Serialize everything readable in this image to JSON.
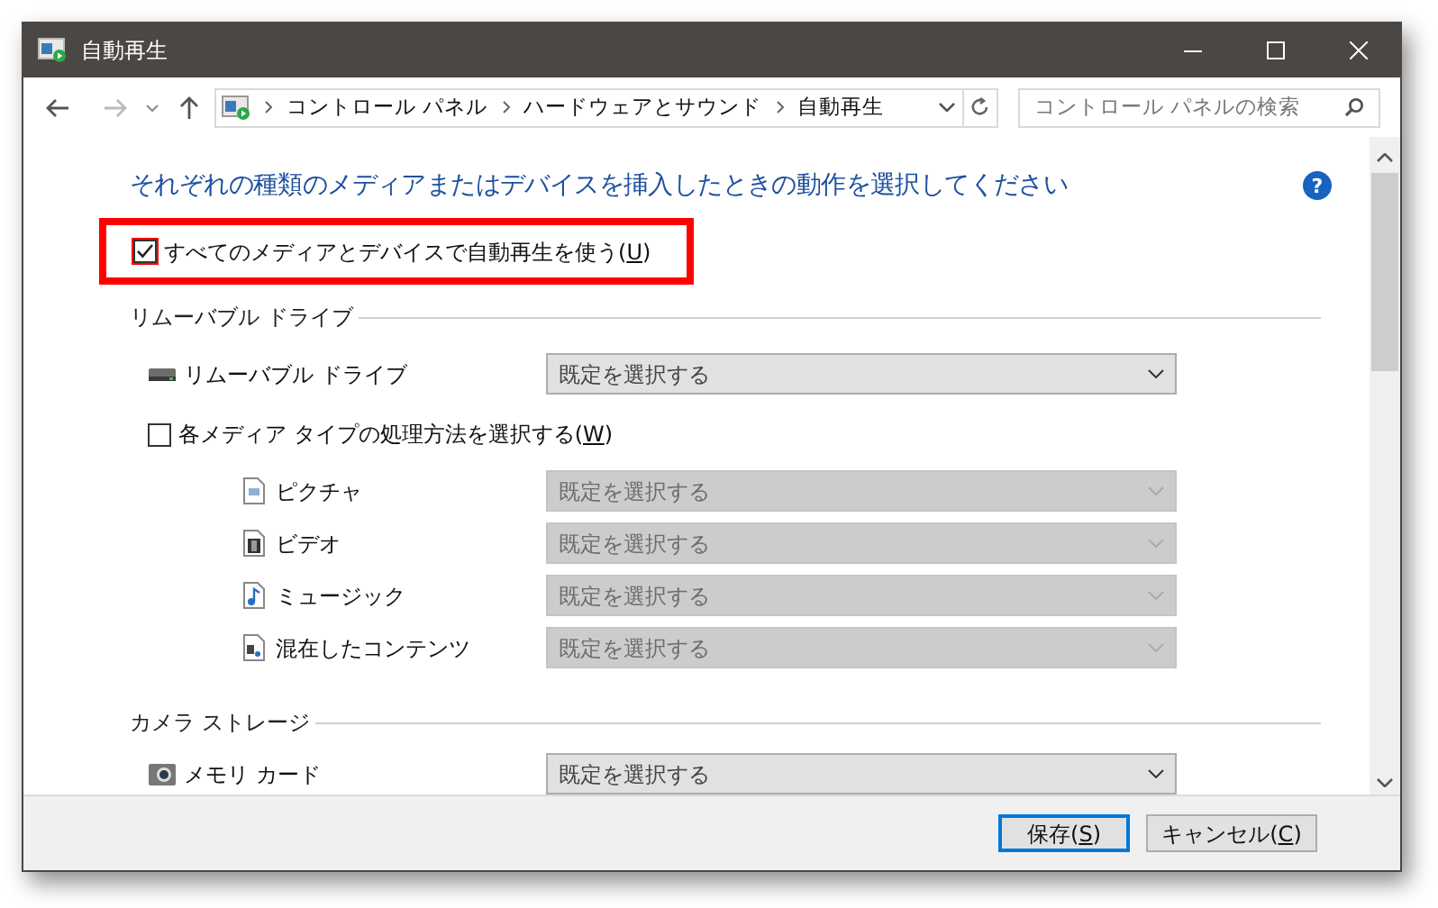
{
  "window": {
    "title": "自動再生"
  },
  "address_bar": {
    "crumbs": [
      "コントロール パネル",
      "ハードウェアとサウンド",
      "自動再生"
    ]
  },
  "search": {
    "placeholder": "コントロール パネルの検索"
  },
  "heading": "それぞれの種類のメディアまたはデバイスを挿入したときの動作を選択してください",
  "help_button": "?",
  "autoplay_option": {
    "label_before": "すべてのメディアとデバイスで自動再生を使う(",
    "accesskey": "U",
    "label_after": ")",
    "checked": true,
    "highlighted": true
  },
  "sections": [
    {
      "title": "リムーバブル ドライブ",
      "items": [
        {
          "kind": "device",
          "label": "リムーバブル ドライブ",
          "dropdown": {
            "value": "既定を選択する",
            "disabled": false
          }
        },
        {
          "kind": "checkbox",
          "label_before": "各メディア タイプの処理方法を選択する(",
          "accesskey": "W",
          "label_after": ")",
          "checked": false
        },
        {
          "kind": "media",
          "label": "ピクチャ",
          "dropdown": {
            "value": "既定を選択する",
            "disabled": true
          }
        },
        {
          "kind": "media",
          "label": "ビデオ",
          "dropdown": {
            "value": "既定を選択する",
            "disabled": true
          }
        },
        {
          "kind": "media",
          "label": "ミュージック",
          "dropdown": {
            "value": "既定を選択する",
            "disabled": true
          }
        },
        {
          "kind": "media",
          "label": "混在したコンテンツ",
          "dropdown": {
            "value": "既定を選択する",
            "disabled": true
          }
        }
      ]
    },
    {
      "title": "カメラ ストレージ",
      "items": [
        {
          "kind": "device",
          "label": "メモリ カード",
          "dropdown": {
            "value": "既定を選択する",
            "disabled": false
          }
        }
      ]
    }
  ],
  "buttons": [
    {
      "label_before": "保存(",
      "accesskey": "S",
      "label_after": ")",
      "default": true
    },
    {
      "label_before": "キャンセル(",
      "accesskey": "C",
      "label_after": ")",
      "default": false
    }
  ]
}
